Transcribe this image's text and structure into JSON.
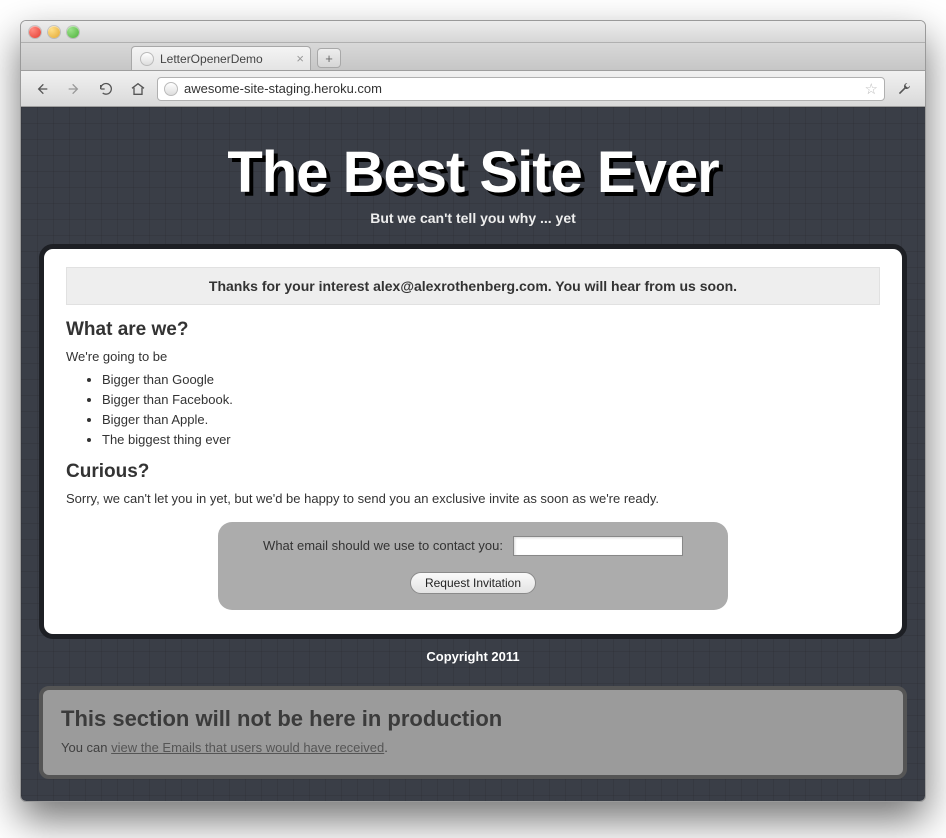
{
  "browser": {
    "tab_title": "LetterOpenerDemo",
    "url": "awesome-site-staging.heroku.com"
  },
  "hero": {
    "title": "The Best Site Ever",
    "subtitle": "But we can't tell you why ... yet"
  },
  "flash": "Thanks for your interest alex@alexrothenberg.com. You will hear from us soon.",
  "section1": {
    "heading": "What are we?",
    "intro": "We're going to be",
    "bullets": [
      "Bigger than Google",
      "Bigger than Facebook.",
      "Bigger than Apple.",
      "The biggest thing ever"
    ]
  },
  "section2": {
    "heading": "Curious?",
    "text": "Sorry, we can't let you in yet, but we'd be happy to send you an exclusive invite as soon as we're ready."
  },
  "form": {
    "label": "What email should we use to contact you:",
    "value": "",
    "submit": "Request Invitation"
  },
  "footer": "Copyright 2011",
  "staging": {
    "heading": "This section will not be here in production",
    "prefix": "You can ",
    "link": "view the Emails that users would have received",
    "suffix": "."
  }
}
